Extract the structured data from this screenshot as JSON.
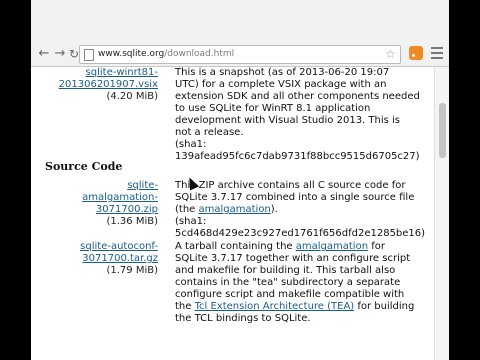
{
  "browser": {
    "url_prefix": "www.sqlite.org",
    "url_path": "/download.html"
  },
  "snapshot_row": {
    "link_line1": "sqlite-winrt81-",
    "link_line2": "201306201907.vsix",
    "size": "(4.20 MiB)",
    "desc_lines": [
      "This is a snapshot (as of 2013-06-20 19:07",
      "UTC) for a complete VSIX package with an",
      "extension SDK and all other components needed",
      "to use SQLite for WinRT 8.1 application",
      "development with Visual Studio 2013. This is",
      "not a release.",
      "(sha1:",
      "139afead95fc6c7dab9731f88bcc9515d6705c27)"
    ]
  },
  "source_code": {
    "title": "Source Code",
    "amalgamation": {
      "link_line1": "sqlite-",
      "link_line2": "amalgamation-",
      "link_line3": "3071700.zip",
      "size": "(1.36 MiB)",
      "desc_line1": "This ZIP archive contains all C source code for",
      "desc_line2": "SQLite 3.7.17 combined into a single source file",
      "desc_line3_pre": "(the ",
      "desc_line3_link": "amalgamation",
      "desc_line3_post": ").",
      "sha_line1": "(sha1:",
      "sha_line2": "5cd468d429e23c927ed1761f656dfd2e1285be16)"
    },
    "autoconf": {
      "link_line1": "sqlite-autoconf-",
      "link_line2": "3071700.tar.gz",
      "size": "(1.79 MiB)",
      "desc_line1_pre": "A tarball containing the ",
      "desc_line1_link": "amalgamation",
      "desc_line1_post": " for",
      "desc_line2": "SQLite 3.7.17 together with an configure script",
      "desc_line3": "and makefile for building it. This tarball also",
      "desc_line4": "contains in the \"tea\" subdirectory a separate",
      "desc_line5": "configure script and makefile compatible with",
      "desc_line6_pre": "the ",
      "desc_line6_link": "Tcl Extension Architecture (TEA)",
      "desc_line6_post": " for building",
      "desc_line7": "the TCL bindings to SQLite."
    }
  }
}
